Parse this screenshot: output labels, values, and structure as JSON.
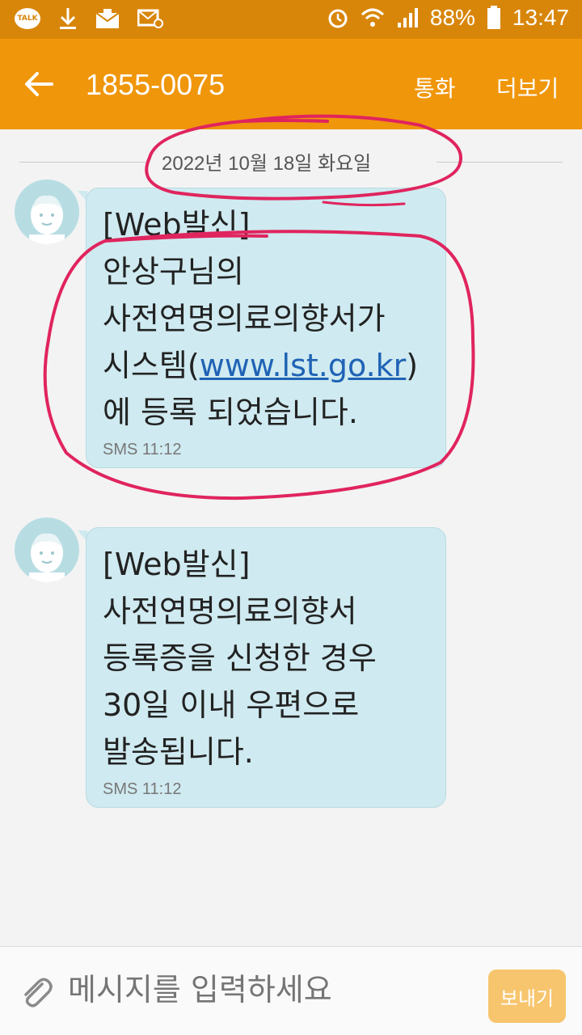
{
  "status_bar": {
    "talk_label": "TALK",
    "battery": "88%",
    "time": "13:47",
    "icons": [
      "kakaotalk-icon",
      "download-icon",
      "mail-icon",
      "email-at-icon",
      "alarm-icon",
      "wifi-icon",
      "signal-icon",
      "battery-icon"
    ]
  },
  "app_bar": {
    "title": "1855-0075",
    "call_label": "통화",
    "more_label": "더보기"
  },
  "date_divider": "2022년 10월 18일 화요일",
  "messages": [
    {
      "text_before_link": "[Web발신]\n안상구님의\n사전연명의료의향서가\n시스템(",
      "link": "www.lst.go.kr",
      "text_after_link": ")에 등록 되었습니다.",
      "meta": "SMS 11:12"
    },
    {
      "text": "[Web발신]\n사전연명의료의향서\n등록증을 신청한 경우\n30일 이내 우편으로\n발송됩니다.",
      "meta": "SMS 11:12"
    }
  ],
  "composer": {
    "placeholder": "메시지를 입력하세요",
    "send_label": "보내기"
  },
  "colors": {
    "status_bar": "#d8860a",
    "app_bar": "#f0960a",
    "bubble": "#cfeaf0",
    "annotation": "#e0245e",
    "send_button": "#f7c56e"
  }
}
